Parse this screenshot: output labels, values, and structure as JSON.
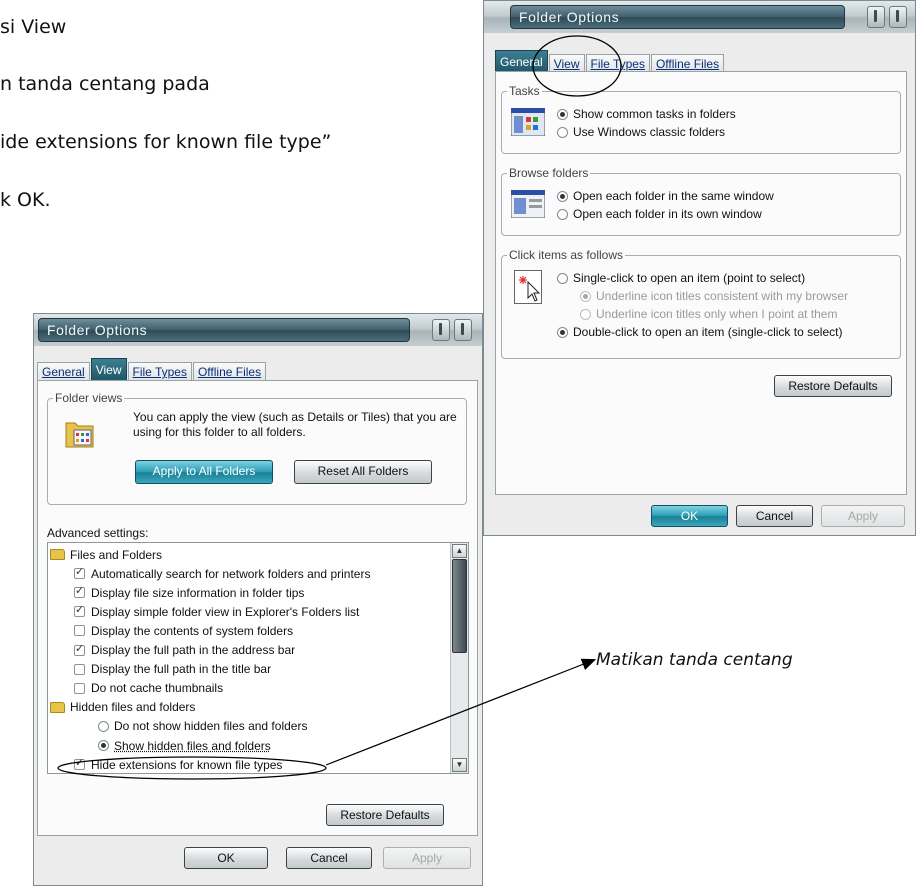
{
  "document": {
    "lines": [
      "si View",
      "n tanda centang pada",
      "ide extensions for known file type”",
      "k OK."
    ],
    "annotation": "Matikan tanda centang"
  },
  "dialog_general": {
    "title": "Folder Options",
    "tabs": [
      "General",
      "View",
      "File Types",
      "Offline Files"
    ],
    "tasks": {
      "label": "Tasks",
      "options": [
        "Show common tasks in folders",
        "Use Windows classic folders"
      ]
    },
    "browse": {
      "label": "Browse folders",
      "options": [
        "Open each folder in the same window",
        "Open each folder in its own window"
      ]
    },
    "click": {
      "label": "Click items as follows",
      "options": [
        "Single-click to open an item (point to select)",
        "Underline icon titles consistent with my browser",
        "Underline icon titles only when I point at them",
        "Double-click to open an item (single-click to select)"
      ]
    },
    "restore_defaults": "Restore Defaults",
    "ok": "OK",
    "cancel": "Cancel",
    "apply": "Apply"
  },
  "dialog_view": {
    "title": "Folder Options",
    "tabs": [
      "General",
      "View",
      "File Types",
      "Offline Files"
    ],
    "folder_views": {
      "label": "Folder views",
      "text": "You can apply the view (such as Details or Tiles) that you are using for this folder to all folders.",
      "apply_all": "Apply to All Folders",
      "reset_all": "Reset All Folders"
    },
    "advanced_label": "Advanced settings:",
    "settings": [
      {
        "type": "folder",
        "label": "Files and Folders"
      },
      {
        "type": "check",
        "checked": true,
        "label": "Automatically search for network folders and printers"
      },
      {
        "type": "check",
        "checked": true,
        "label": "Display file size information in folder tips"
      },
      {
        "type": "check",
        "checked": true,
        "label": "Display simple folder view in Explorer's Folders list"
      },
      {
        "type": "check",
        "checked": false,
        "label": "Display the contents of system folders"
      },
      {
        "type": "check",
        "checked": true,
        "label": "Display the full path in the address bar"
      },
      {
        "type": "check",
        "checked": false,
        "label": "Display the full path in the title bar"
      },
      {
        "type": "check",
        "checked": false,
        "label": "Do not cache thumbnails"
      },
      {
        "type": "folder",
        "label": "Hidden files and folders"
      },
      {
        "type": "radio",
        "checked": false,
        "label": "Do not show hidden files and folders"
      },
      {
        "type": "radio",
        "checked": true,
        "label": "Show hidden files and folders"
      },
      {
        "type": "check",
        "checked": true,
        "label": "Hide extensions for known file types"
      }
    ],
    "restore_defaults": "Restore Defaults",
    "ok": "OK",
    "cancel": "Cancel",
    "apply": "Apply"
  }
}
